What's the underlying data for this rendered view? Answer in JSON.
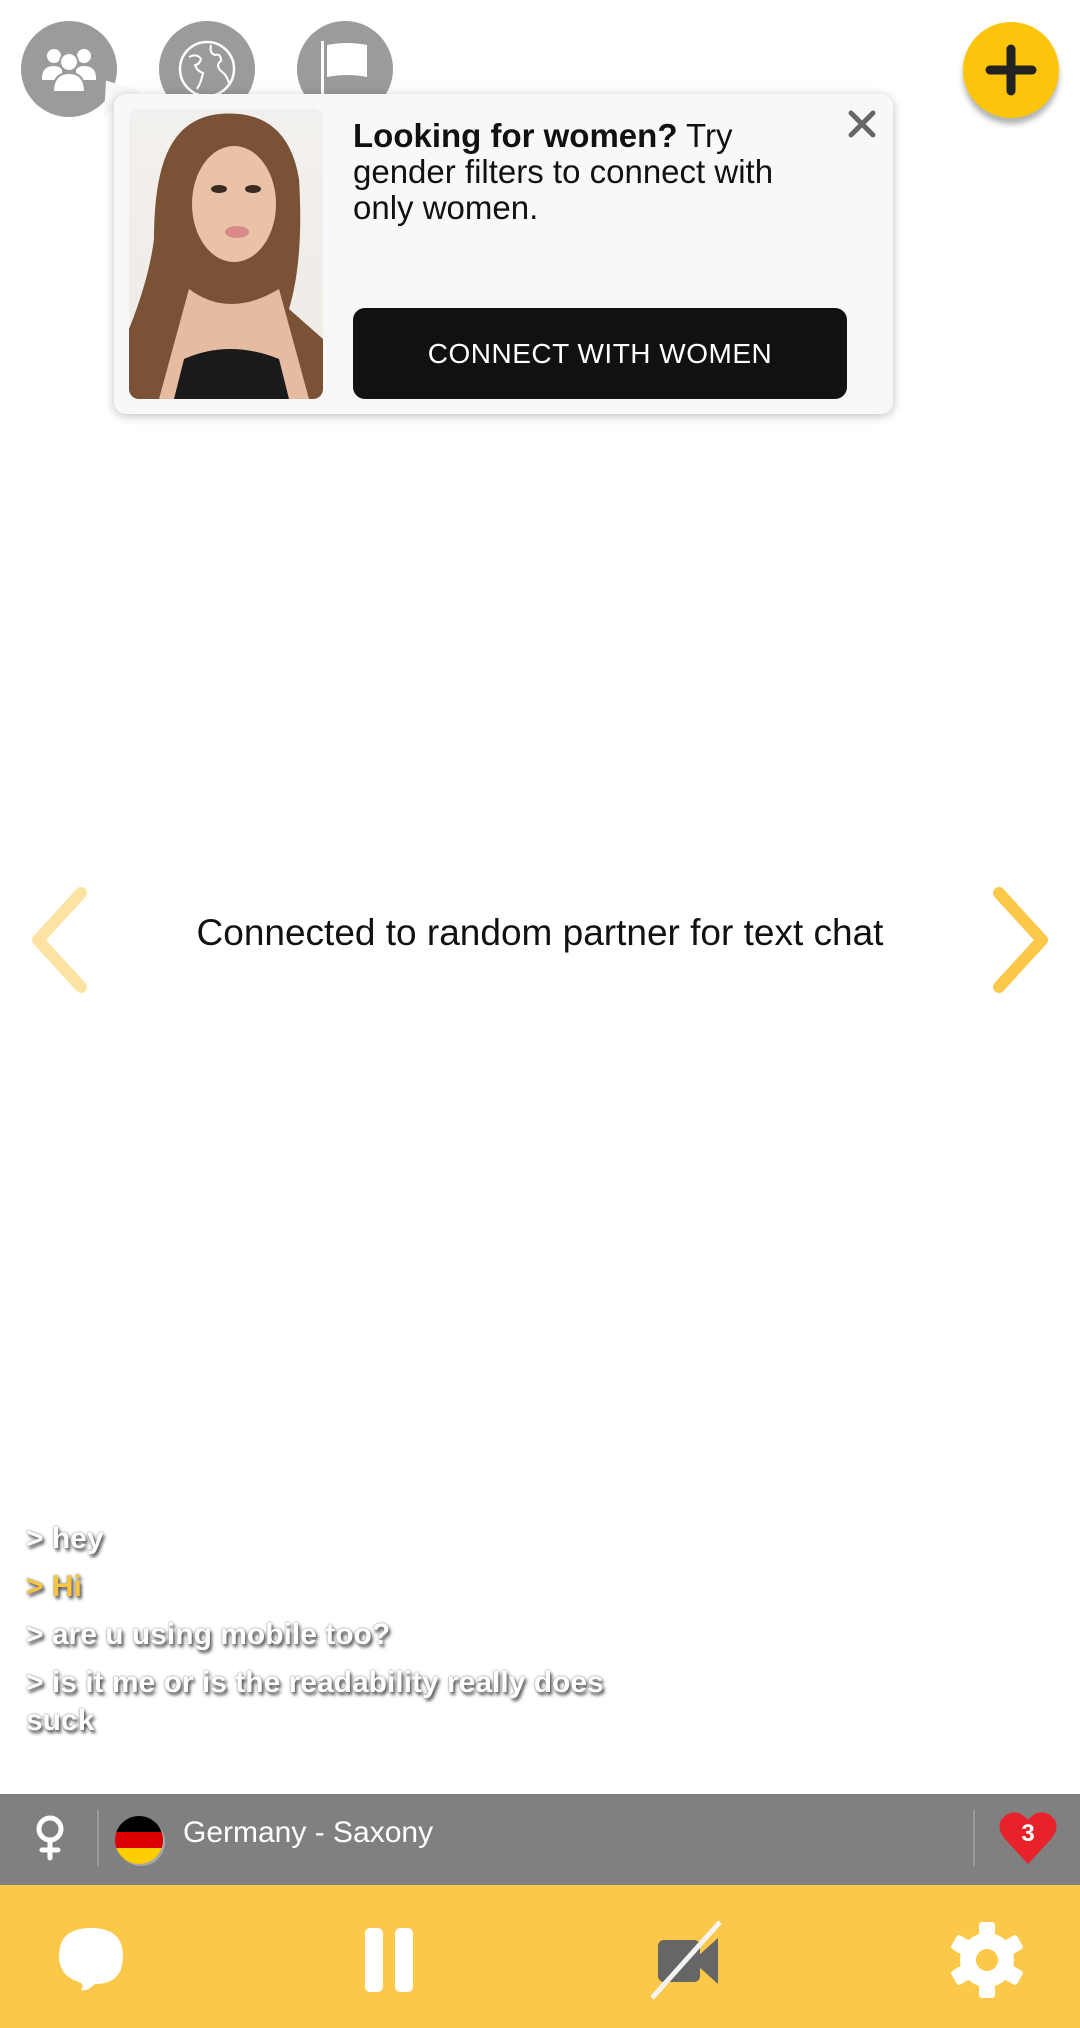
{
  "top_nav": {
    "buttons": [
      {
        "icon": "people-icon",
        "label": "Interests"
      },
      {
        "icon": "globe-icon",
        "label": "Location"
      },
      {
        "icon": "flag-icon",
        "label": "Report"
      }
    ],
    "add_button_icon": "plus-icon"
  },
  "promo": {
    "headline": "Looking for women?",
    "body": " Try gender filters to connect with only women.",
    "cta_label": "CONNECT WITH WOMEN",
    "close_icon": "close-icon"
  },
  "main": {
    "status_text": "Connected to random partner for text chat"
  },
  "chat": {
    "messages": [
      {
        "text": "> hey",
        "from": "partner"
      },
      {
        "text": "> Hi",
        "from": "me"
      },
      {
        "text": "> are u using mobile too?",
        "from": "partner"
      },
      {
        "text": "> is it me or is the readability really does suck",
        "from": "partner"
      }
    ]
  },
  "info_bar": {
    "gender_icon": "female-icon",
    "country_flag": "germany-flag",
    "location": "Germany - Saxony",
    "likes_count": "3"
  },
  "toolbar": {
    "items": [
      "chat-icon",
      "pause-icon",
      "video-off-icon",
      "settings-icon"
    ]
  },
  "colors": {
    "accent_yellow": "#fbc84a",
    "fab_yellow": "#fdc40c",
    "info_gray": "#808080",
    "heart_red": "#e8222b"
  }
}
